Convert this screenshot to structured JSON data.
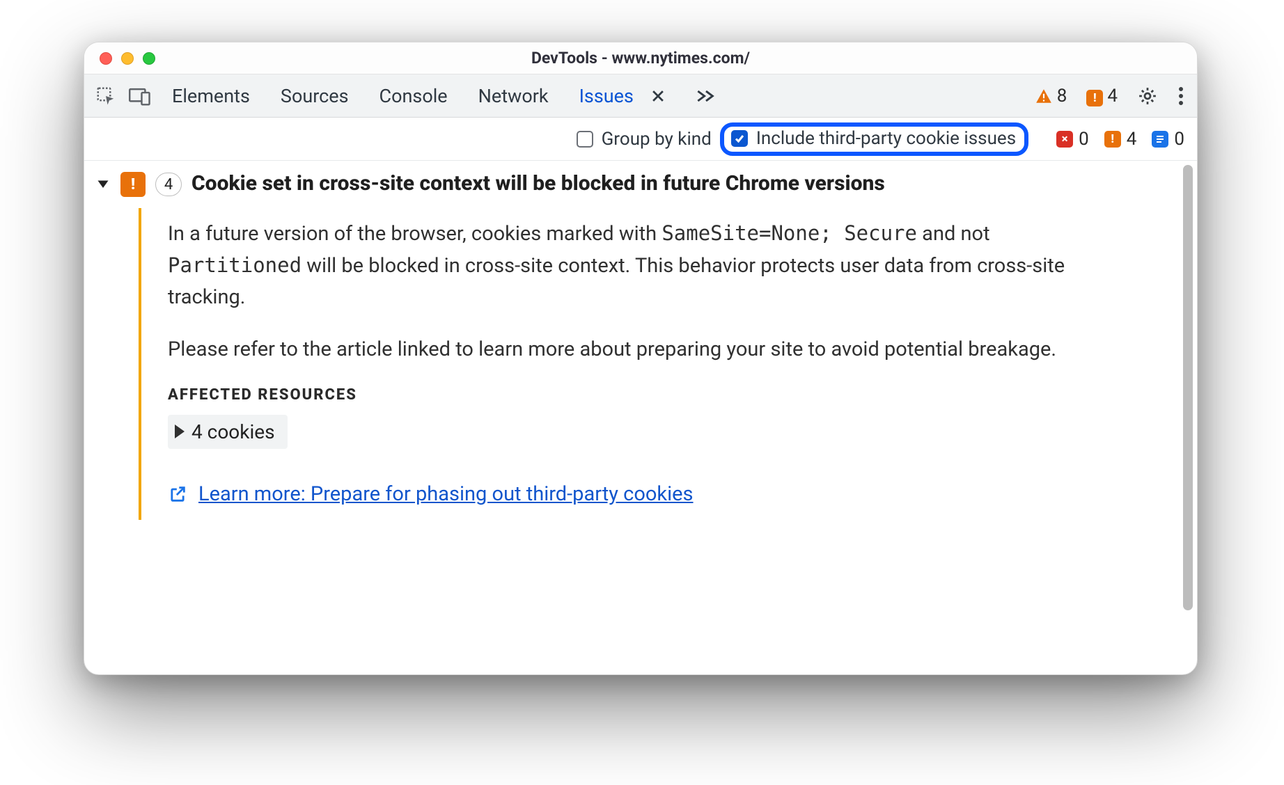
{
  "window": {
    "title": "DevTools - www.nytimes.com/"
  },
  "tabs": {
    "elements": "Elements",
    "sources": "Sources",
    "console": "Console",
    "network": "Network",
    "issues": "Issues"
  },
  "toolbar_counts": {
    "errors": "8",
    "warnings": "4"
  },
  "filter": {
    "group_by_kind_label": "Group by kind",
    "group_by_kind_checked": false,
    "include_tp_label": "Include third-party cookie issues",
    "include_tp_checked": true
  },
  "filter_counts": {
    "red": "0",
    "orange": "4",
    "blue": "0"
  },
  "issue": {
    "count": "4",
    "title": "Cookie set in cross-site context will be blocked in future Chrome versions",
    "p1_a": "In a future version of the browser, cookies marked with ",
    "p1_code1": "SameSite=None; Secure",
    "p1_b": " and not ",
    "p1_code2": "Partitioned",
    "p1_c": " will be blocked in cross-site context. This behavior protects user data from cross-site tracking.",
    "p2": "Please refer to the article linked to learn more about preparing your site to avoid potential breakage.",
    "affected_header": "AFFECTED RESOURCES",
    "affected_item": "4 cookies",
    "learn_more": "Learn more: Prepare for phasing out third-party cookies"
  }
}
